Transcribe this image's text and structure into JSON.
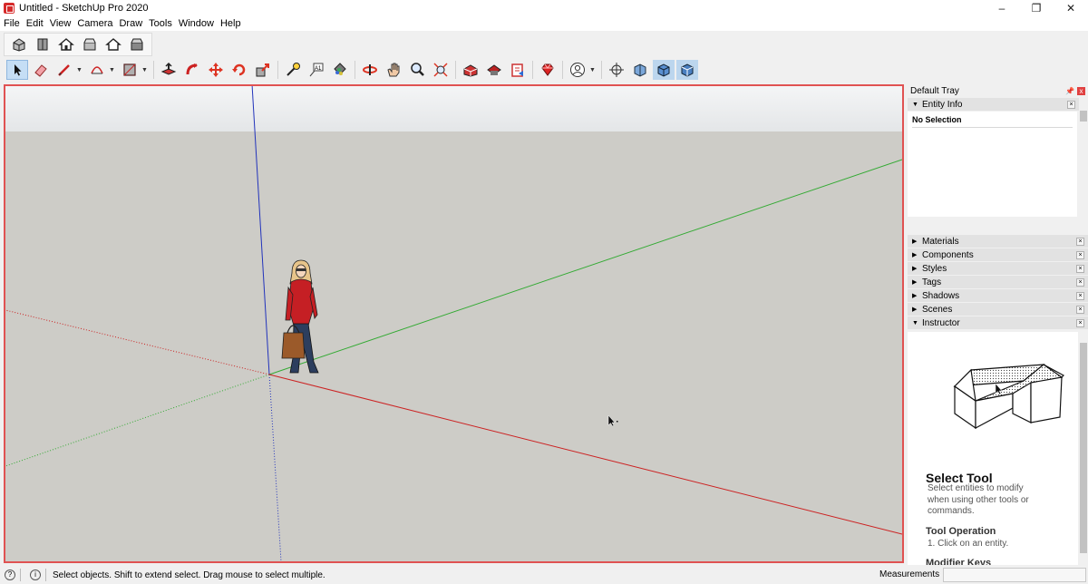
{
  "window": {
    "title": "Untitled - SketchUp Pro 2020",
    "minimize": "–",
    "restore": "❐",
    "close": "✕"
  },
  "menu": [
    "File",
    "Edit",
    "View",
    "Camera",
    "Draw",
    "Tools",
    "Window",
    "Help"
  ],
  "colors": {
    "selection_border": "#e05252",
    "sky": "#eef0f1",
    "ground": "#cdccc7",
    "axis_red": "#cc2222",
    "axis_green": "#33aa33",
    "axis_blue": "#2233bb"
  },
  "toolbar_views": [
    "iso-view-icon",
    "top-view-icon",
    "front-view-icon",
    "right-view-icon",
    "back-view-icon",
    "left-view-icon"
  ],
  "tray": {
    "title": "Default Tray",
    "pin": "📌",
    "close": "x",
    "entity_info": {
      "label": "Entity Info",
      "close": "×",
      "value": "No Selection"
    },
    "panels": [
      {
        "label": "Materials",
        "close": "×"
      },
      {
        "label": "Components",
        "close": "×"
      },
      {
        "label": "Styles",
        "close": "×"
      },
      {
        "label": "Tags",
        "close": "×"
      },
      {
        "label": "Shadows",
        "close": "×"
      },
      {
        "label": "Scenes",
        "close": "×"
      }
    ],
    "instructor": {
      "label": "Instructor",
      "close": "×",
      "title": "Select Tool",
      "description": "Select entities to modify when using other tools or commands.",
      "operation_title": "Tool Operation",
      "operation_step": "1. Click on an entity.",
      "modifier_title": "Modifier Keys"
    }
  },
  "status": {
    "help_icon": "?",
    "info_icon": "i",
    "text": "Select objects. Shift to extend select. Drag mouse to select multiple.",
    "measurements_label": "Measurements",
    "measurements_value": ""
  }
}
